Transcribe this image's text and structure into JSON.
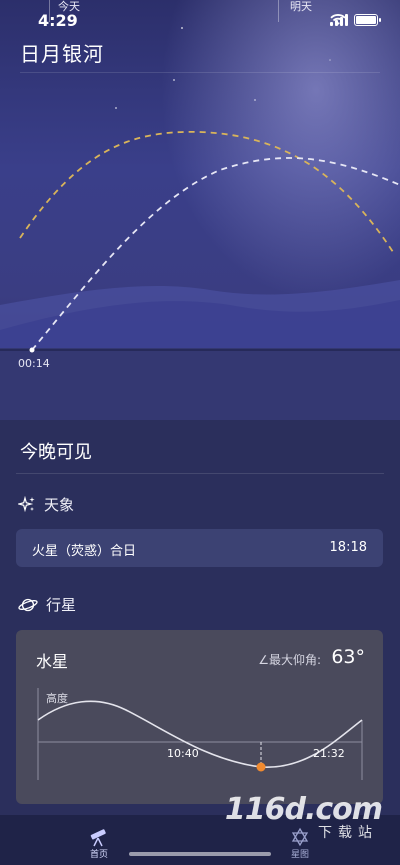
{
  "status_bar": {
    "time": "4:29",
    "day_today": "今天",
    "day_tomorrow": "明天"
  },
  "header": {
    "title": "日月银河"
  },
  "sky_chart": {
    "start_time": "00:14"
  },
  "tonight": {
    "title": "今晚可见",
    "celestial_heading": "天象",
    "event": {
      "name": "火星（荧惑）合日",
      "time": "18:18"
    },
    "planets_heading": "行星",
    "planet_card": {
      "name": "水星",
      "max_altitude_label": "∠最大仰角:",
      "max_altitude_value": "63°",
      "altitude_axis_label": "高度",
      "rise_time": "10:40",
      "set_time": "21:32"
    }
  },
  "tabbar": {
    "home_label": "首页",
    "starmap_label": "星图"
  },
  "watermark": {
    "main": "116d.com",
    "sub": "下载站"
  },
  "colors": {
    "sun_curve": "#d9b45a",
    "moon_curve": "#e6e6f5",
    "planet_marker": "#f08a30"
  }
}
